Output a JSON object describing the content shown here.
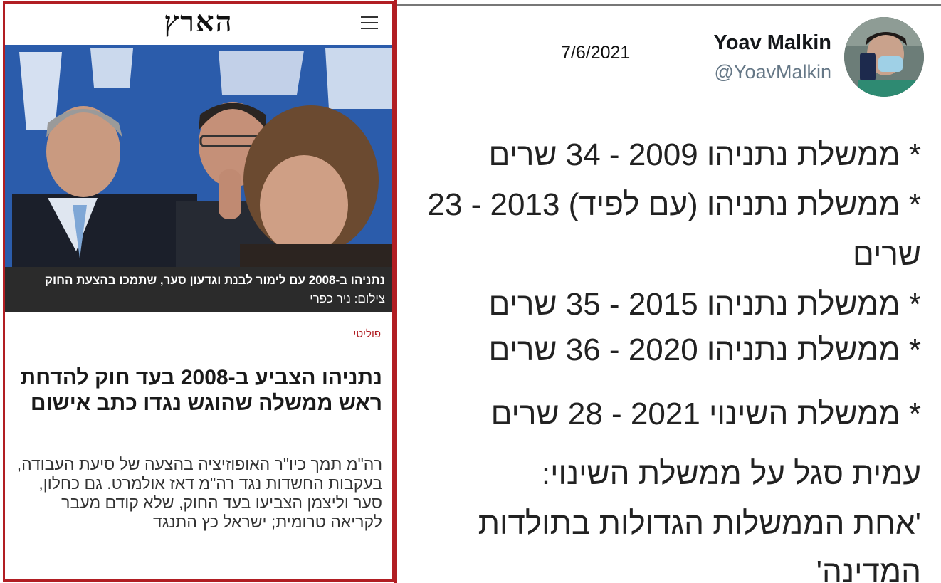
{
  "left": {
    "logo": "הארץ",
    "photo_caption_bold": "נתניהו ב-2008 עם לימור לבנת וגדעון סער, שתמכו בהצעת החוק",
    "photo_credit": "צילום: ניר כפרי",
    "section": "פוליטי",
    "headline": "נתניהו הצביע ב-2008 בעד חוק להדחת ראש ממשלה שהוגש נגדו כתב אישום",
    "lede": "רה\"מ תמך כיו\"ר האופוזיציה בהצעה של סיעת העבודה, בעקבות החשדות נגד רה\"מ דאז אולמרט. גם כחלון, סער וליצמן הצביעו בעד החוק, שלא קודם מעבר לקריאה טרומית; ישראל כץ התנגד"
  },
  "tweet": {
    "date": "7/6/2021",
    "name": "Yoav Malkin",
    "handle": "@YoavMalkin",
    "lines": [
      "* ממשלת נתניהו 2009 - 34 שרים",
      "* ממשלת נתניהו (עם לפיד) 2013 - 23",
      "שרים",
      "* ממשלת נתניהו 2015 - 35 שרים",
      "* ממשלת נתניהו 2020 - 36 שרים",
      "* ממשלת השינוי 2021 - 28 שרים"
    ],
    "quote_intro": "עמית סגל על ממשלת השינוי:",
    "quote_line_1": "'אחת הממשלות הגדולות בתולדות",
    "quote_line_2": "המדינה'"
  },
  "colors": {
    "haaretz_red": "#b11e23",
    "caption_bg": "#2b2b2b",
    "handle_gray": "#657786"
  },
  "icons": {
    "menu": "menu-icon"
  }
}
